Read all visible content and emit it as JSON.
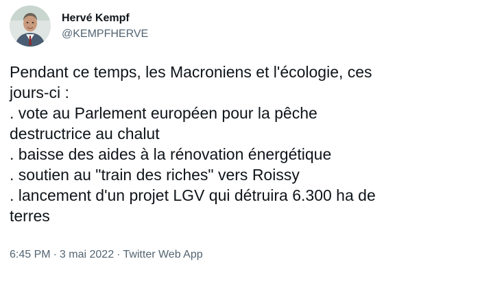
{
  "author": {
    "display_name": "Hervé Kempf",
    "handle": "@KEMPFHERVE",
    "avatar_icon": "profile-photo"
  },
  "tweet": {
    "lines": [
      "Pendant ce temps, les Macroniens et l'écologie, ces",
      "jours-ci :",
      ". vote au Parlement européen pour la pêche",
      "destructrice au chalut",
      ". baisse des aides à la rénovation énergétique",
      ". soutien au \"train des riches\" vers Roissy",
      ". lancement d'un projet LGV qui détruira 6.300 ha de",
      "terres"
    ]
  },
  "meta": {
    "time": "6:45 PM",
    "separator": "·",
    "date": "3 mai 2022",
    "source": "Twitter Web App"
  },
  "colors": {
    "text": "#0f1419",
    "secondary": "#536471",
    "background": "#ffffff"
  }
}
